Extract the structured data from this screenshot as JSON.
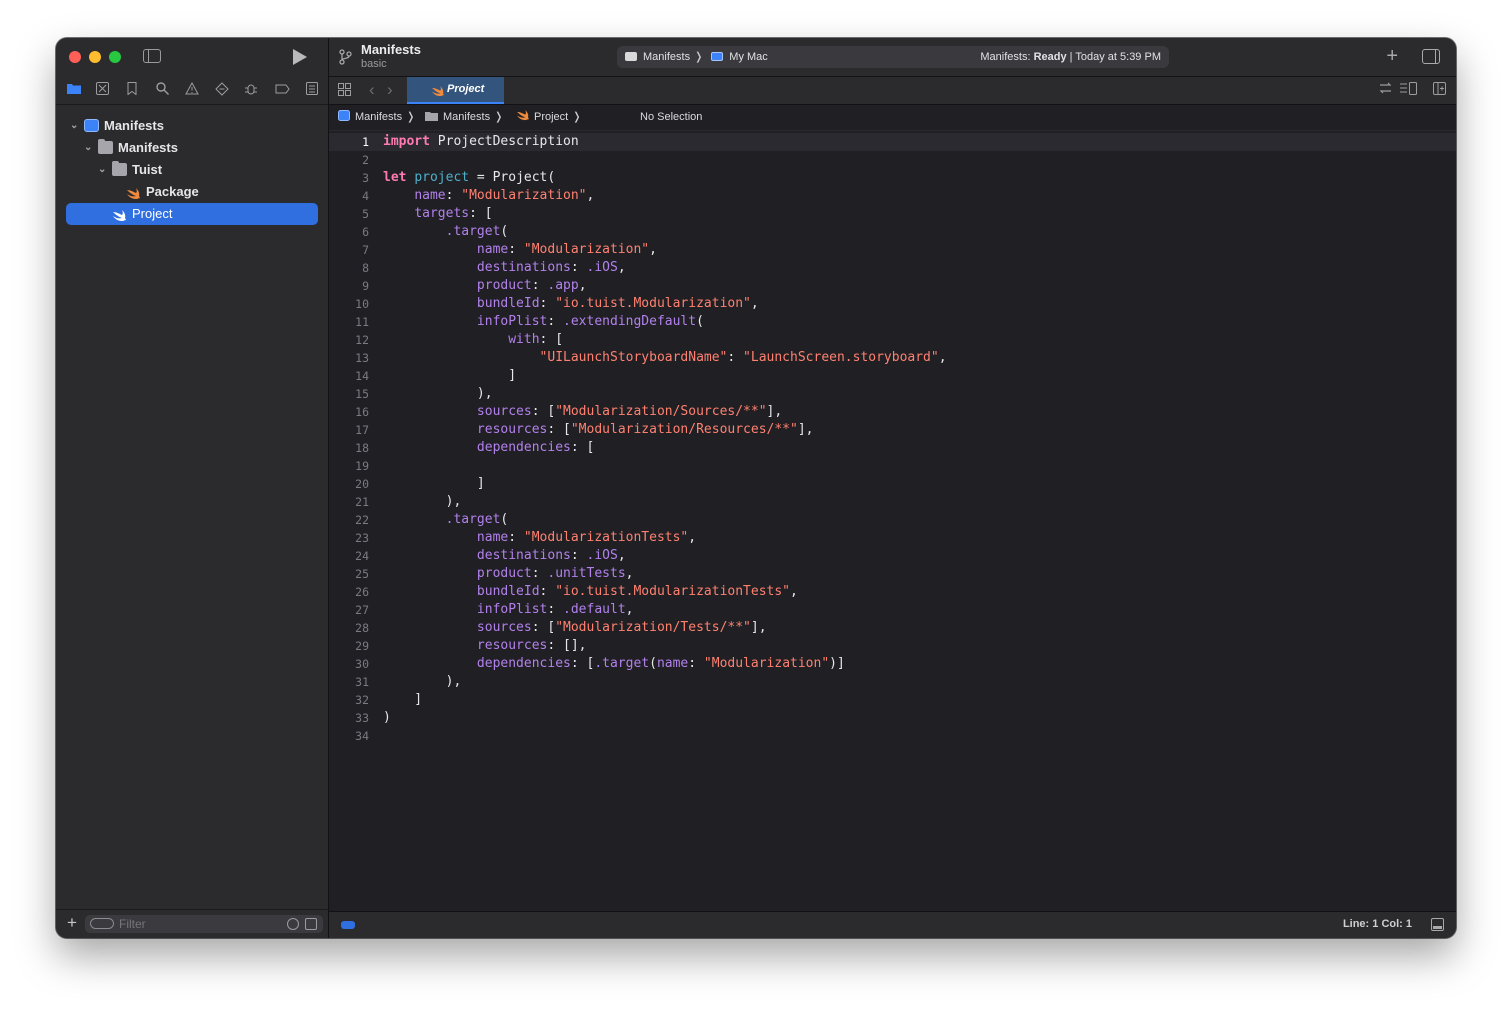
{
  "window": {
    "project_title": "Manifests",
    "project_subtitle": "basic",
    "scheme": "Manifests",
    "destination": "My Mac",
    "status_prefix": "Manifests: ",
    "status_state": "Ready",
    "status_time": " | Today at 5:39 PM"
  },
  "sidebar": {
    "tree": [
      {
        "label": "Manifests",
        "kind": "project-icon",
        "depth": 0,
        "expanded": true
      },
      {
        "label": "Manifests",
        "kind": "folder-icon",
        "depth": 1,
        "expanded": true
      },
      {
        "label": "Tuist",
        "kind": "folder-icon",
        "depth": 2,
        "expanded": true
      },
      {
        "label": "Package",
        "kind": "swift-file-icon",
        "depth": 3,
        "expanded": false
      },
      {
        "label": "Project",
        "kind": "swift-file-icon",
        "depth": 2,
        "expanded": false,
        "selected": true
      }
    ],
    "filter_placeholder": "Filter"
  },
  "tab": {
    "label": "Project"
  },
  "jumpbar": {
    "items": [
      "Manifests",
      "Manifests",
      "Project",
      "No Selection"
    ]
  },
  "editor": {
    "current_line": 1,
    "lines": [
      "import ProjectDescription",
      "",
      "let project = Project(",
      "    name: \"Modularization\",",
      "    targets: [",
      "        .target(",
      "            name: \"Modularization\",",
      "            destinations: .iOS,",
      "            product: .app,",
      "            bundleId: \"io.tuist.Modularization\",",
      "            infoPlist: .extendingDefault(",
      "                with: [",
      "                    \"UILaunchStoryboardName\": \"LaunchScreen.storyboard\",",
      "                ]",
      "            ),",
      "            sources: [\"Modularization/Sources/**\"],",
      "            resources: [\"Modularization/Resources/**\"],",
      "            dependencies: [",
      "",
      "            ]",
      "        ),",
      "        .target(",
      "            name: \"ModularizationTests\",",
      "            destinations: .iOS,",
      "            product: .unitTests,",
      "            bundleId: \"io.tuist.ModularizationTests\",",
      "            infoPlist: .default,",
      "            sources: [\"Modularization/Tests/**\"],",
      "            resources: [],",
      "            dependencies: [.target(name: \"Modularization\")]",
      "        ),",
      "    ]",
      ")",
      ""
    ]
  },
  "statusbar": {
    "line_col": "Line: 1  Col: 1"
  },
  "colors": {
    "keyword": "#ff7ab2",
    "string": "#ff8170",
    "property": "#b281eb",
    "declaration": "#4eb0cc",
    "accent": "#2f6fe0"
  }
}
